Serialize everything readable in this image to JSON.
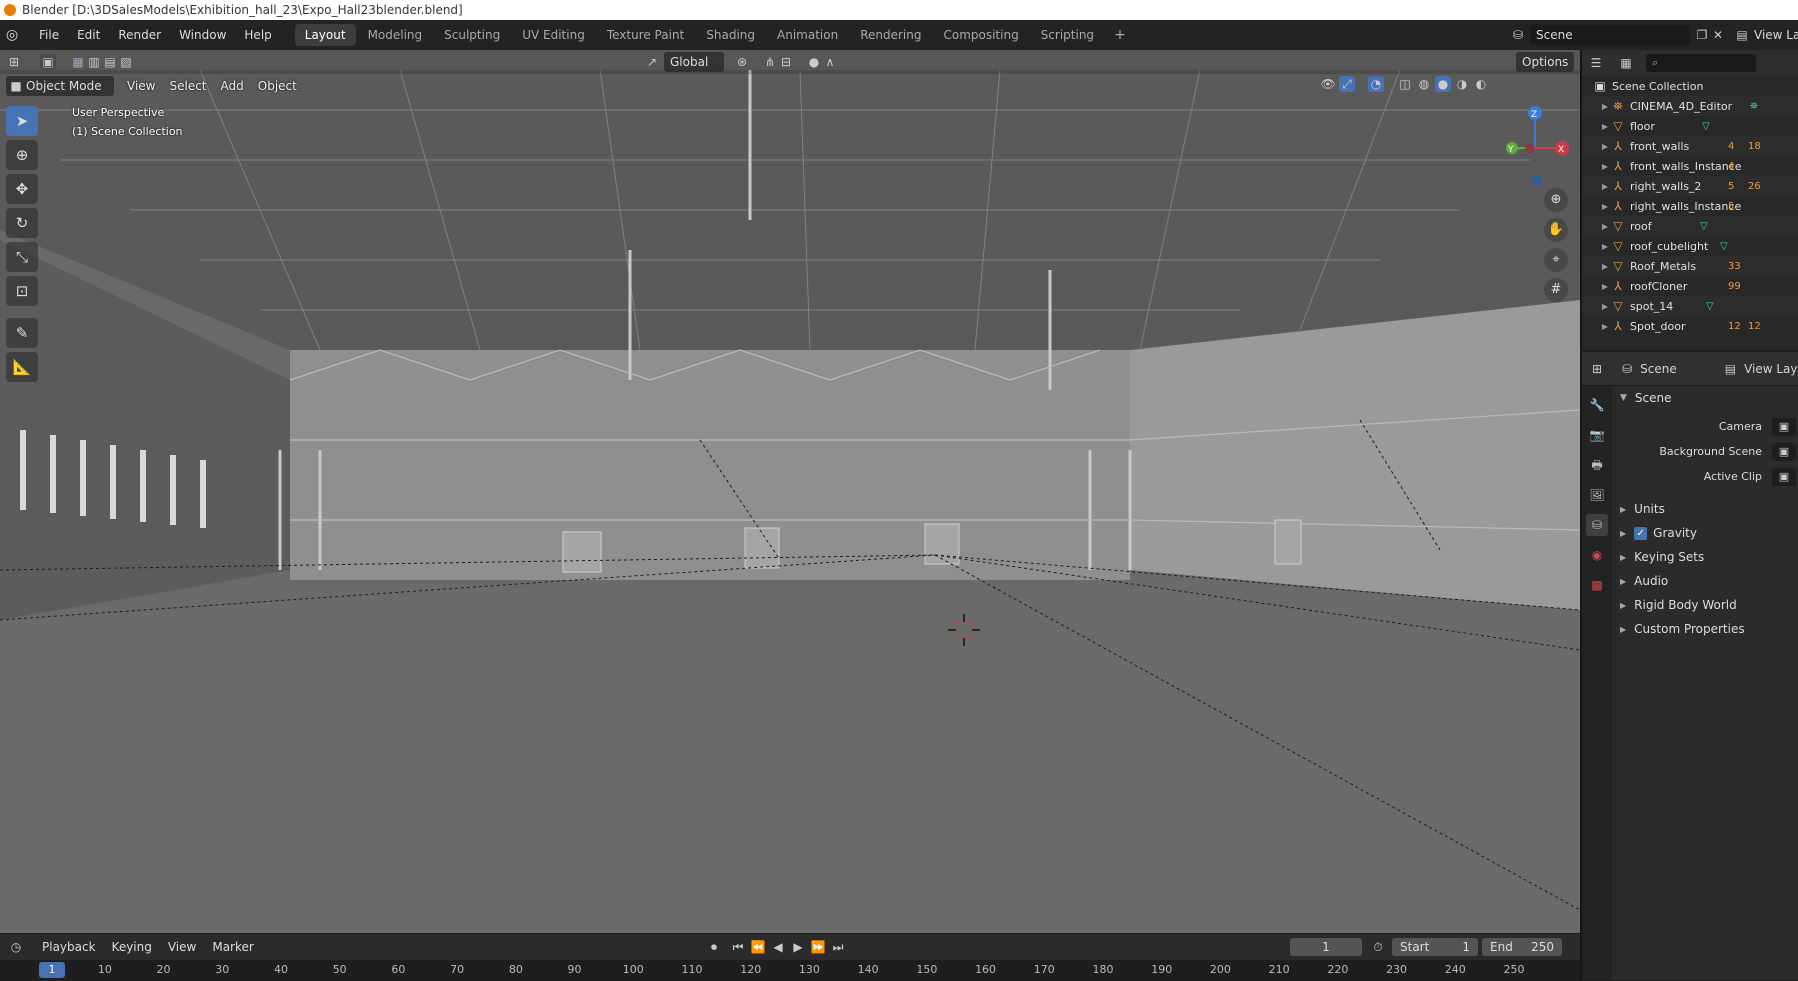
{
  "window_title": "Blender [D:\\3DSalesModels\\Exhibition_hall_23\\Expo_Hall23blender.blend]",
  "menu": [
    "File",
    "Edit",
    "Render",
    "Window",
    "Help"
  ],
  "workspaces": [
    "Layout",
    "Modeling",
    "Sculpting",
    "UV Editing",
    "Texture Paint",
    "Shading",
    "Animation",
    "Rendering",
    "Compositing",
    "Scripting"
  ],
  "active_workspace": "Layout",
  "scene_name": "Scene",
  "view_layer_label": "View Lay",
  "viewport": {
    "mode": "Object Mode",
    "menus": [
      "View",
      "Select",
      "Add",
      "Object"
    ],
    "transform_orientation": "Global",
    "options_label": "Options",
    "perspective_label": "User Perspective",
    "collection_label": "(1) Scene Collection",
    "gizmo_axes": {
      "x": "X",
      "y": "Y",
      "z": "Z"
    }
  },
  "outliner": {
    "root": "Scene Collection",
    "items": [
      {
        "name": "CINEMA_4D_Editor",
        "icon": "camera-icon"
      },
      {
        "name": "floor",
        "icon": "mesh-icon"
      },
      {
        "name": "front_walls",
        "icon": "empty-icon",
        "badges": [
          "4",
          "18"
        ]
      },
      {
        "name": "front_walls_Instance",
        "icon": "empty-icon",
        "badges": [
          "4"
        ]
      },
      {
        "name": "right_walls_2",
        "icon": "empty-icon",
        "badges": [
          "5",
          "26"
        ]
      },
      {
        "name": "right_walls_Instance",
        "icon": "empty-icon",
        "badges": [
          "5"
        ]
      },
      {
        "name": "roof",
        "icon": "mesh-icon"
      },
      {
        "name": "roof_cubelight",
        "icon": "mesh-icon"
      },
      {
        "name": "Roof_Metals",
        "icon": "mesh-icon",
        "badges": [
          "33"
        ]
      },
      {
        "name": "roofCloner",
        "icon": "empty-icon",
        "badges": [
          "99"
        ]
      },
      {
        "name": "spot_14",
        "icon": "mesh-icon"
      },
      {
        "name": "Spot_door",
        "icon": "empty-icon",
        "badges": [
          "12",
          "12"
        ]
      }
    ]
  },
  "properties": {
    "tabs": [
      "Scene",
      "View Layer"
    ],
    "section": "Scene",
    "fields": [
      {
        "label": "Camera"
      },
      {
        "label": "Background Scene"
      },
      {
        "label": "Active Clip"
      }
    ],
    "subsections": [
      "Units",
      "Gravity",
      "Keying Sets",
      "Audio",
      "Rigid Body World",
      "Custom Properties"
    ],
    "gravity_checked": true
  },
  "timeline": {
    "menus": [
      "Playback",
      "Keying",
      "View",
      "Marker"
    ],
    "current_frame": "1",
    "start_label": "Start",
    "start": "1",
    "end_label": "End",
    "end": "250",
    "ticks": [
      "1",
      "10",
      "20",
      "30",
      "40",
      "50",
      "60",
      "70",
      "80",
      "90",
      "100",
      "110",
      "120",
      "130",
      "140",
      "150",
      "160",
      "170",
      "180",
      "190",
      "200",
      "210",
      "220",
      "230",
      "240",
      "250"
    ]
  }
}
